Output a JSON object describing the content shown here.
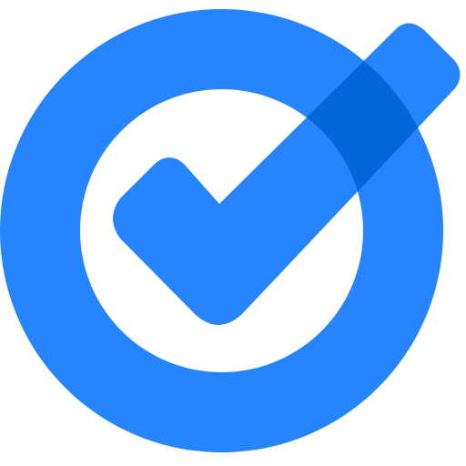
{
  "logo": {
    "icon": "check-circle-icon",
    "colors": {
      "ring": "#2684FC",
      "check": "#2684FC",
      "overlap": "#0066DA",
      "inner": "#FFFFFF",
      "background": "#FFFFFF"
    }
  }
}
